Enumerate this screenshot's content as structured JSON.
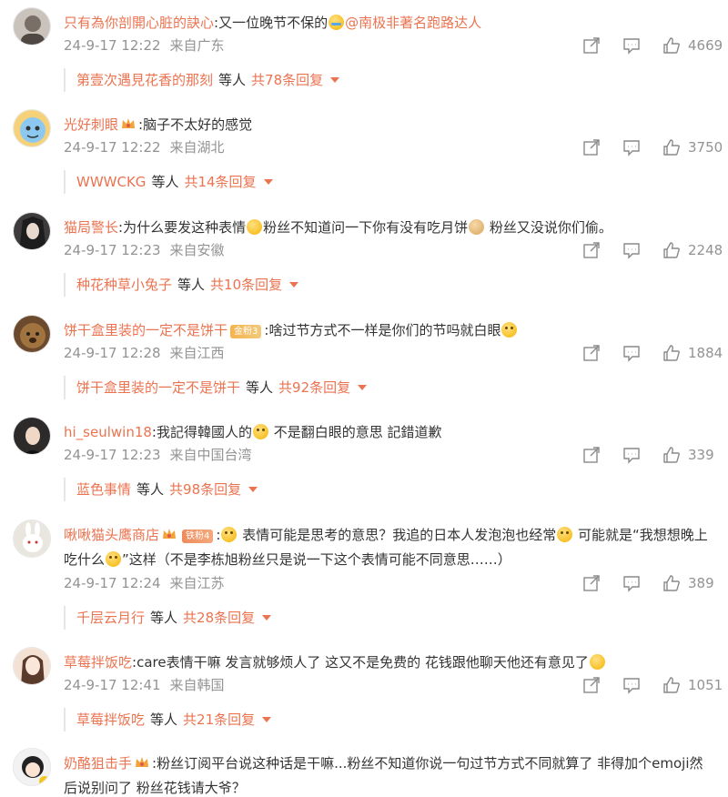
{
  "comments": [
    {
      "username": "只有為你剖開心脏的訣心",
      "text_before": ":又一位晚节不保的",
      "mention": "@南极非著名跑路达人",
      "time": "24-9-17 12:22",
      "location": "来自广东",
      "likes": "4669",
      "reply_user": "第壹次遇見花香的那刻",
      "reply_etc": "等人",
      "reply_count": "共78条回复"
    },
    {
      "username": "光好刺眼",
      "text_before": ":脑子不太好的感觉",
      "time": "24-9-17 12:22",
      "location": "来自湖北",
      "likes": "3750",
      "reply_user": "WWWCKG",
      "reply_etc": "等人",
      "reply_count": "共14条回复"
    },
    {
      "username": "猫局警长",
      "text_before": ":为什么要发这种表情",
      "text_mid": "粉丝不知道问一下你有没有吃月饼",
      "text_after": " 粉丝又没说你们偷。",
      "time": "24-9-17 12:23",
      "location": "来自安徽",
      "likes": "2248",
      "reply_user": "种花种草小兔子",
      "reply_etc": "等人",
      "reply_count": "共10条回复"
    },
    {
      "username": "饼干盒里装的一定不是饼干",
      "badge": "金粉3",
      "text_before": ":啥过节方式不一样是你们的节吗就白眼",
      "time": "24-9-17 12:28",
      "location": "来自江西",
      "likes": "1884",
      "reply_user": "饼干盒里装的一定不是饼干",
      "reply_etc": "等人",
      "reply_count": "共92条回复"
    },
    {
      "username": "hi_seulwin18",
      "text_before": ":我記得韓國人的",
      "text_mid": " 不是翻白眼的意思 記錯道歉",
      "time": "24-9-17 12:23",
      "location": "来自中国台湾",
      "likes": "339",
      "reply_user": "蓝色事情",
      "reply_etc": "等人",
      "reply_count": "共98条回复"
    },
    {
      "username": "啾啾猫头鹰商店",
      "badge": "铁粉4",
      "text_before": ":",
      "text_mid": " 表情可能是思考的意思？我追的日本人发泡泡也经常",
      "text_after": " 可能就是“我想想晚上吃什么",
      "text_end": "”这样（不是李栋旭粉丝只是说一下这个表情可能不同意思……）",
      "time": "24-9-17 12:24",
      "location": "来自江苏",
      "likes": "389",
      "reply_user": "千层云月行",
      "reply_etc": "等人",
      "reply_count": "共28条回复"
    },
    {
      "username": "草莓拌饭吃",
      "text_before": ":care表情干嘛 发言就够烦人了 这又不是免费的 花钱跟他聊天他还有意见了",
      "time": "24-9-17 12:41",
      "location": "来自韩国",
      "likes": "1051",
      "reply_user": "草莓拌饭吃",
      "reply_etc": "等人",
      "reply_count": "共21条回复"
    },
    {
      "username": "奶酪狙击手",
      "text_before": ":粉丝订阅平台说这种话是干嘛...粉丝不知道你说一句过节方式不同就算了 非得加个emoji然后说别问了 粉丝花钱请大爷？"
    }
  ],
  "icons": {
    "share": "share-icon",
    "comment": "comment-icon",
    "like": "thumbs-up-icon"
  },
  "colors": {
    "accent": "#eb7350",
    "meta": "#939393",
    "text": "#333333"
  }
}
